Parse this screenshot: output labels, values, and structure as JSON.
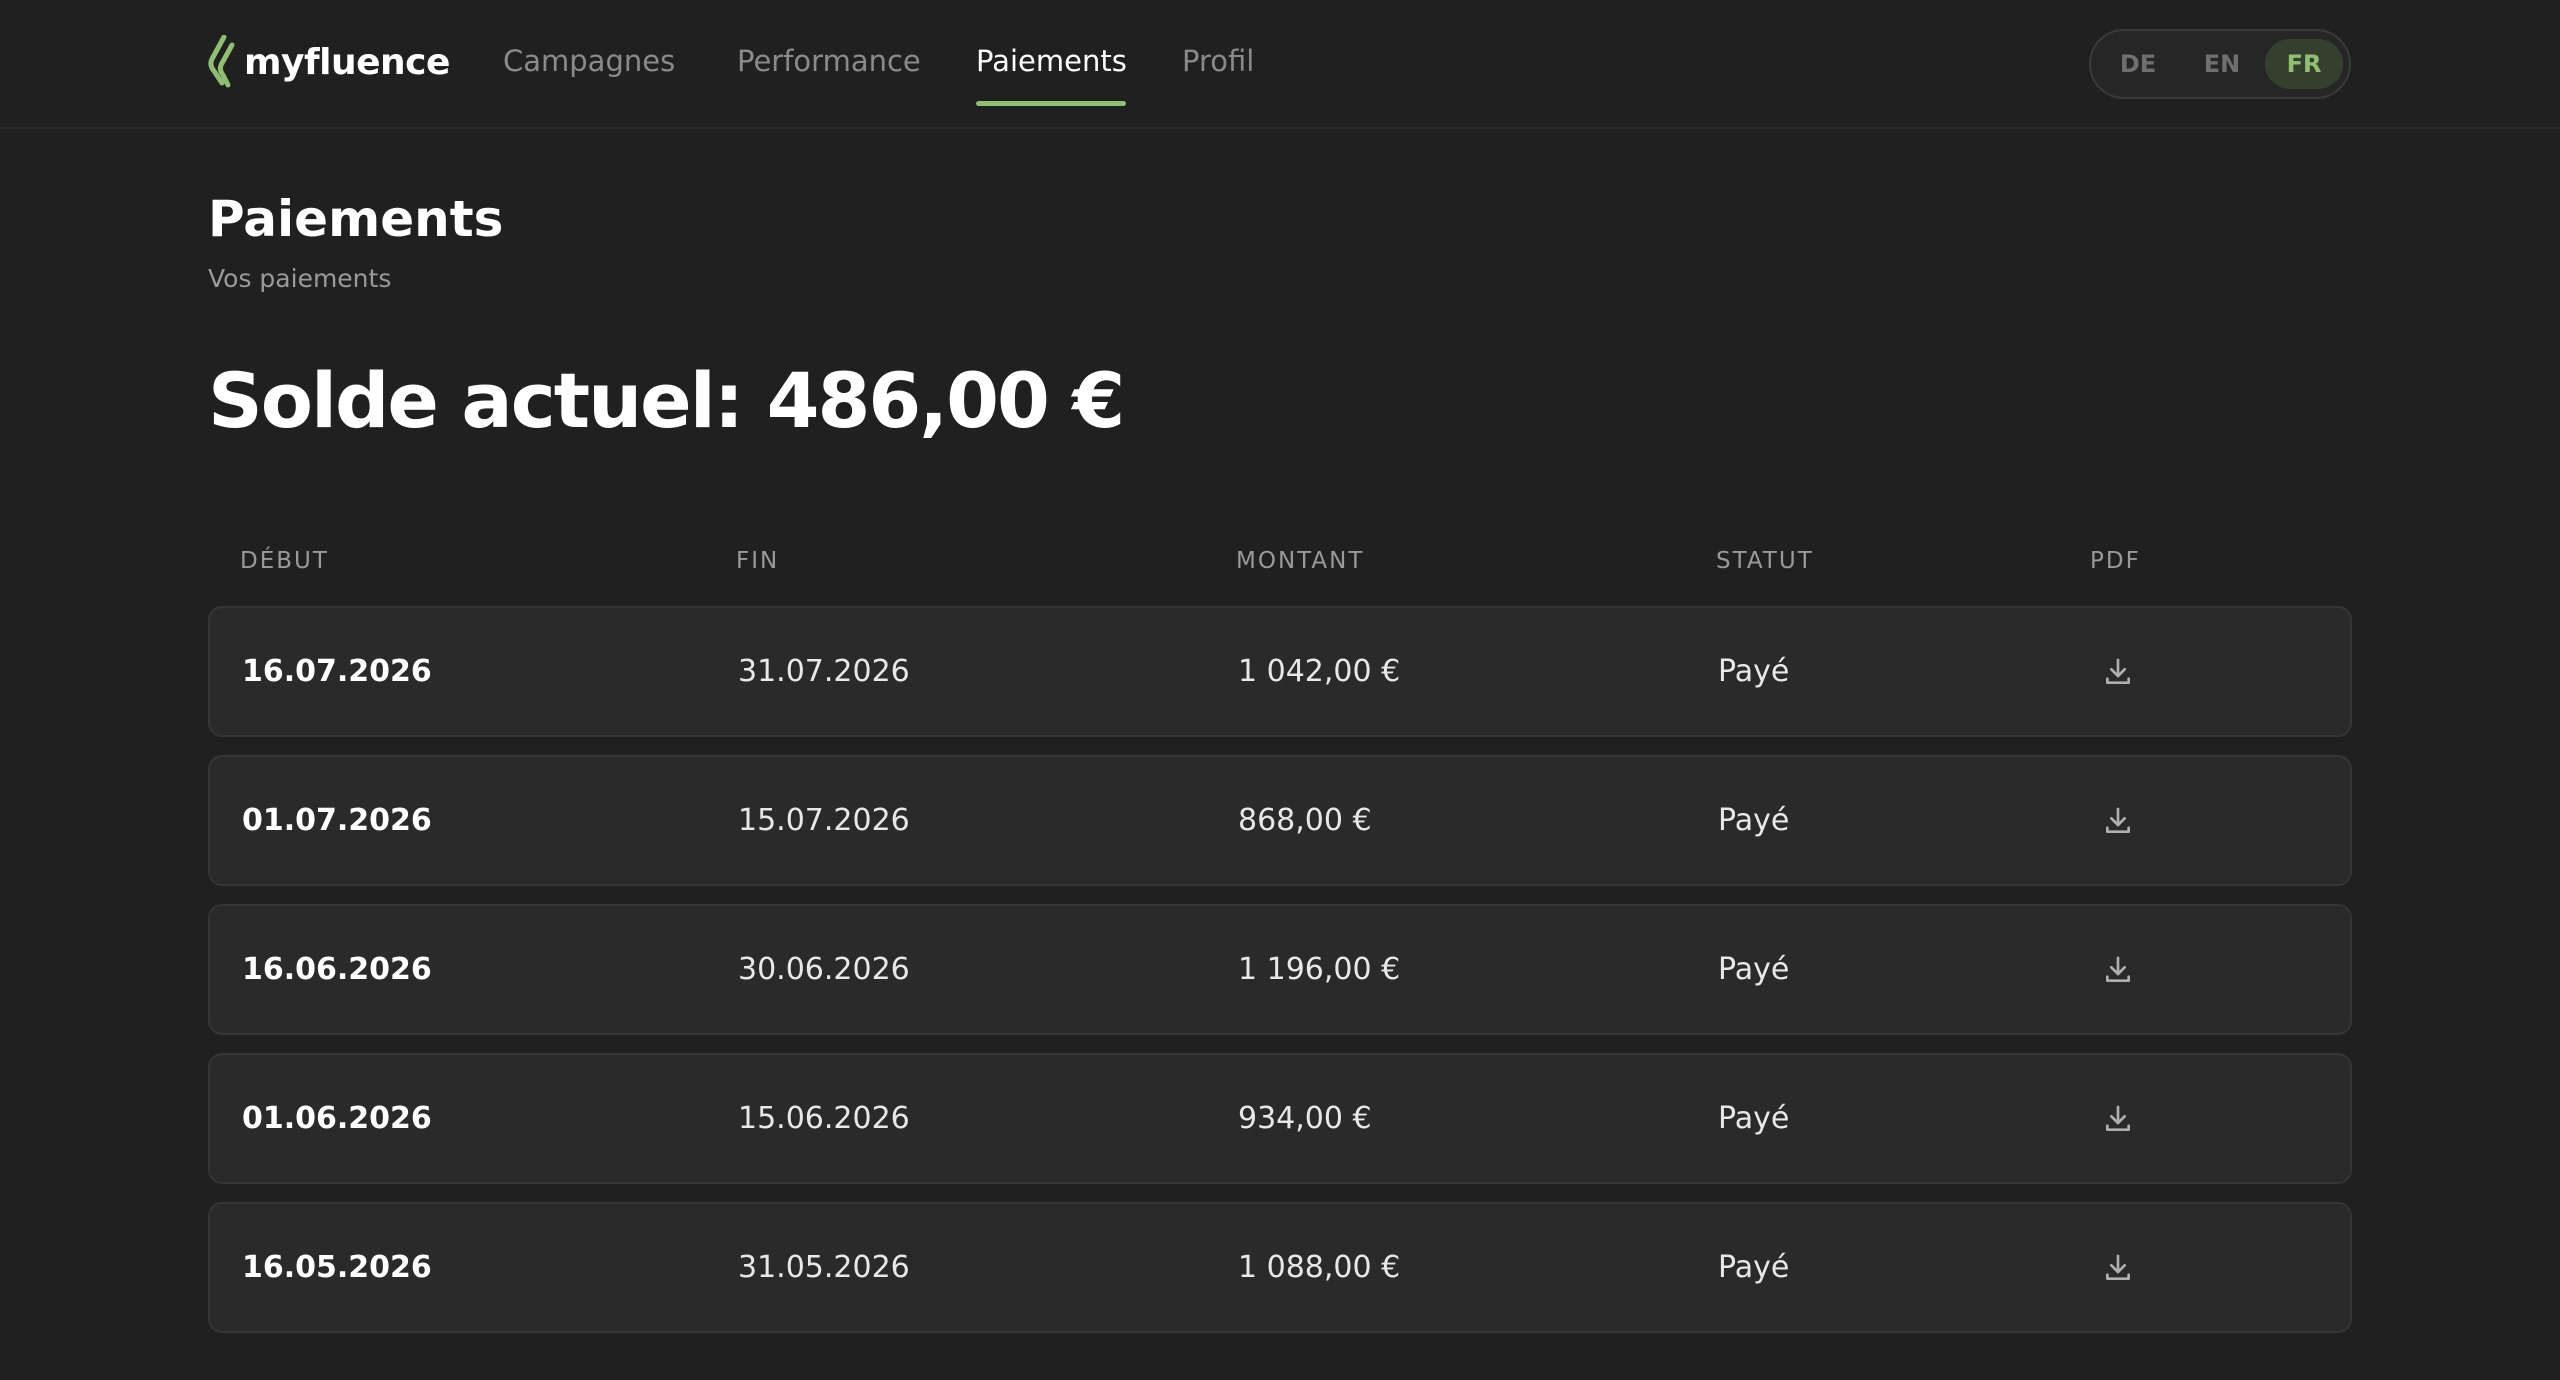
{
  "app": {
    "logo_text": "myfluence",
    "logo_icon": "leaf-logo-icon",
    "accent_color": "#8fbf70"
  },
  "nav": {
    "items": [
      {
        "label": "Campagnes",
        "active": false
      },
      {
        "label": "Performance",
        "active": false
      },
      {
        "label": "Paiements",
        "active": true
      },
      {
        "label": "Profil",
        "active": false
      }
    ]
  },
  "language": {
    "options": [
      "DE",
      "EN",
      "FR"
    ],
    "selected": "FR"
  },
  "page": {
    "title": "Paiements",
    "subtitle": "Vos paiements",
    "balance": "Solde actuel: 486,00 €"
  },
  "table": {
    "columns": [
      "DÉBUT",
      "FIN",
      "MONTANT",
      "STATUT",
      "PDF"
    ],
    "rows": [
      {
        "start": "16.07.2026",
        "end": "31.07.2026",
        "amount": "1 042,00 €",
        "status": "Payé",
        "pdf_icon": "download-icon"
      },
      {
        "start": "01.07.2026",
        "end": "15.07.2026",
        "amount": "868,00 €",
        "status": "Payé",
        "pdf_icon": "download-icon"
      },
      {
        "start": "16.06.2026",
        "end": "30.06.2026",
        "amount": "1 196,00 €",
        "status": "Payé",
        "pdf_icon": "download-icon"
      },
      {
        "start": "01.06.2026",
        "end": "15.06.2026",
        "amount": "934,00 €",
        "status": "Payé",
        "pdf_icon": "download-icon"
      },
      {
        "start": "16.05.2026",
        "end": "31.05.2026",
        "amount": "1 088,00 €",
        "status": "Payé",
        "pdf_icon": "download-icon"
      }
    ]
  }
}
